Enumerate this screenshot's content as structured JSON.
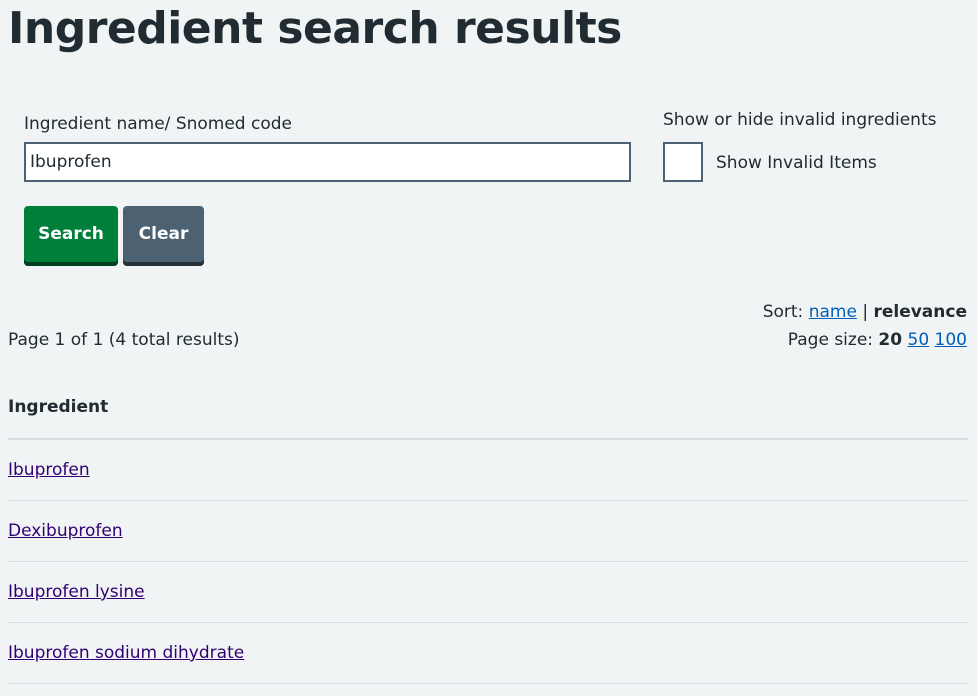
{
  "page": {
    "title": "Ingredient search results"
  },
  "search": {
    "label": "Ingredient name/ Snomed code",
    "value": "Ibuprofen",
    "search_button": "Search",
    "clear_button": "Clear"
  },
  "invalid": {
    "legend": "Show or hide invalid ingredients",
    "checkbox_label": "Show Invalid Items",
    "checked": false
  },
  "sort": {
    "label": "Sort:",
    "options": [
      {
        "label": "name",
        "active": false
      },
      {
        "label": "relevance",
        "active": true
      }
    ],
    "separator": "|"
  },
  "page_size": {
    "label": "Page size:",
    "options": [
      {
        "label": "20",
        "active": true
      },
      {
        "label": "50",
        "active": false
      },
      {
        "label": "100",
        "active": false
      }
    ]
  },
  "pagination": {
    "summary": "Page 1 of 1 (4 total results)"
  },
  "table": {
    "header": "Ingredient",
    "rows": [
      {
        "name": "Ibuprofen"
      },
      {
        "name": "Dexibuprofen"
      },
      {
        "name": "Ibuprofen lysine"
      },
      {
        "name": "Ibuprofen sodium dihydrate"
      }
    ]
  },
  "colors": {
    "background": "#f0f4f5",
    "text": "#212b32",
    "primary_button": "#007f3b",
    "secondary_button": "#4c6272",
    "link": "#005eb8",
    "visited_link": "#330072",
    "border": "#d8dde0"
  }
}
